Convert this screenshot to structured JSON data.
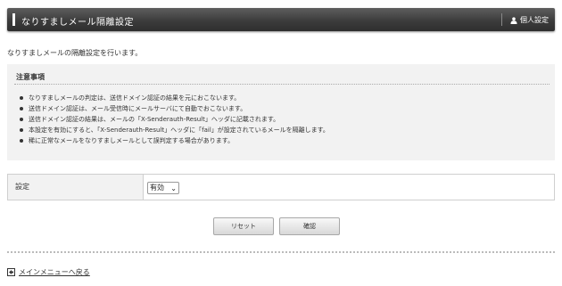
{
  "header": {
    "title": "なりすましメール隔離設定",
    "personal_settings": "個人設定"
  },
  "description": "なりすましメールの隔離設定を行います。",
  "notice": {
    "title": "注意事項",
    "items": [
      "なりすましメールの判定は、送信ドメイン認証の結果を元におこないます。",
      "送信ドメイン認証は、メール受信時にメールサーバにて自動でおこないます。",
      "送信ドメイン認証の結果は、メールの「X-Senderauth-Result」ヘッダに記載されます。",
      "本設定を有効にすると、「X-Senderauth-Result」ヘッダに「fail」が設定されているメールを隔離します。",
      "稀に正常なメールをなりすましメールとして誤判定する場合があります。"
    ]
  },
  "settings": {
    "label": "設定",
    "selected": "有効"
  },
  "buttons": {
    "reset": "リセット",
    "confirm": "確認"
  },
  "back_link": "メインメニューへ戻る",
  "colors": {
    "header_bg": "#3c3c3c",
    "panel_bg": "#f2f2f2"
  }
}
